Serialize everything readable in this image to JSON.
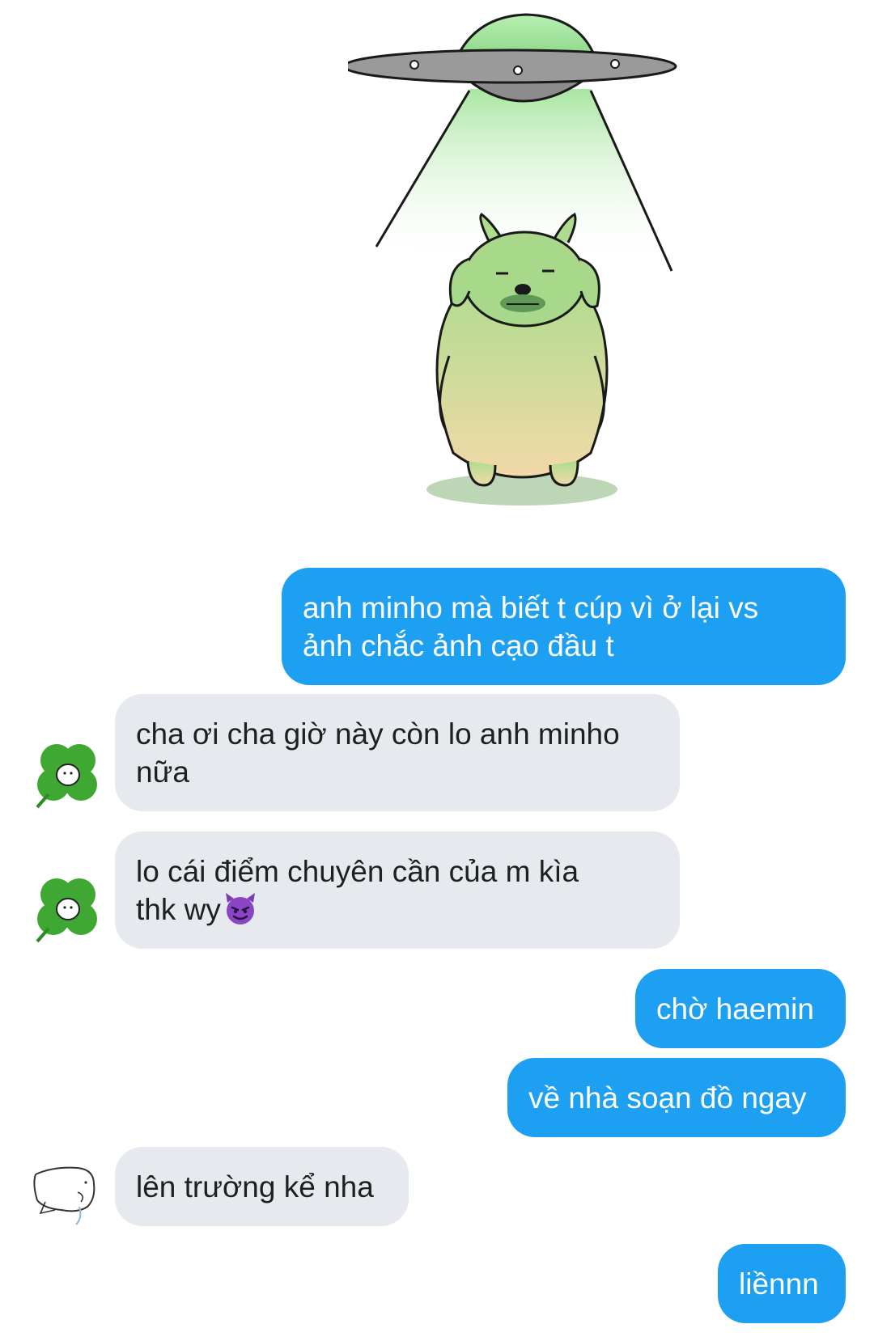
{
  "conversation": {
    "sticker": {
      "icon": "ufo-abducting-dog-sticker"
    },
    "messages": [
      {
        "id": "m1",
        "direction": "sent",
        "lines": [
          "anh minho mà biết t cúp vì ở lại vs",
          "ảnh chắc ảnh cạo đầu t"
        ]
      },
      {
        "id": "m2",
        "direction": "received",
        "avatar": "clover-avatar-icon",
        "lines": [
          "cha ơi cha giờ này còn lo anh minho",
          "nữa"
        ]
      },
      {
        "id": "m3",
        "direction": "received",
        "avatar": "clover-avatar-icon",
        "lines": [
          "lo cái điểm chuyên cần của m kìa",
          "thk wy"
        ],
        "trailing_emoji": "smiling-devil-emoji"
      },
      {
        "id": "m4",
        "direction": "sent",
        "lines": [
          "chờ haemin"
        ]
      },
      {
        "id": "m5",
        "direction": "sent",
        "lines": [
          "về nhà soạn đồ ngay"
        ]
      },
      {
        "id": "m6",
        "direction": "received",
        "avatar": "sketch-animal-avatar-icon",
        "lines": [
          "lên trường kể nha"
        ]
      },
      {
        "id": "m7",
        "direction": "sent",
        "lines": [
          "liềnnn"
        ]
      }
    ]
  },
  "colors": {
    "sent_bubble": "#1ea0f2",
    "received_bubble": "#e6eaee",
    "sent_text": "#ffffff",
    "received_text": "#1f1f1f"
  }
}
